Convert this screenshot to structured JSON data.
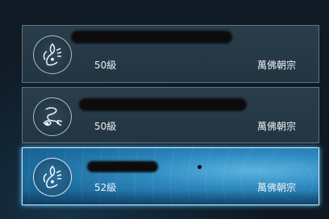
{
  "characters": [
    {
      "level": "50級",
      "server": "萬佛朝宗",
      "emblem": "phoenix-emblem-icon",
      "selected": false
    },
    {
      "level": "50級",
      "server": "萬佛朝宗",
      "emblem": "dragon-emblem-icon",
      "selected": false
    },
    {
      "level": "52級",
      "server": "萬佛朝宗",
      "emblem": "phoenix-emblem-icon",
      "selected": true
    }
  ],
  "colors": {
    "card_bg": "#263a48",
    "selected_bg": "#2f8ac0",
    "text": "#eef3f6"
  }
}
